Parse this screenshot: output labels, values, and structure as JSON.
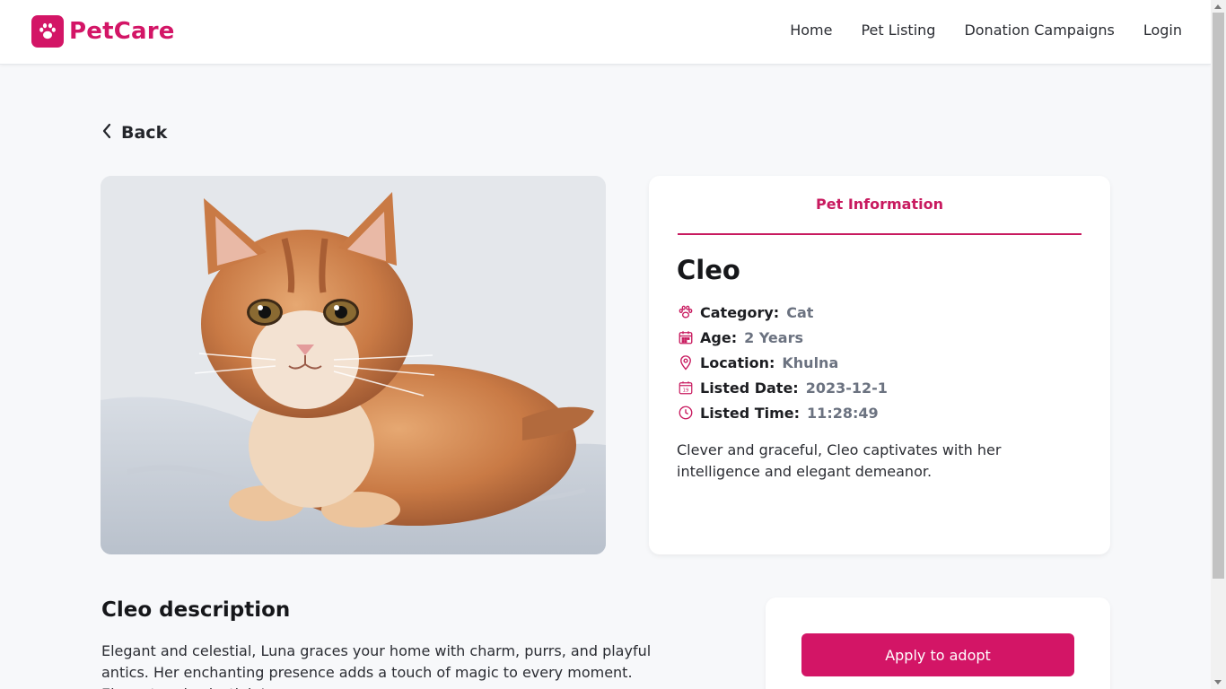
{
  "brand": {
    "name": "PetCare",
    "color": "#d31566",
    "icon": "paw-icon"
  },
  "nav": {
    "items": [
      "Home",
      "Pet Listing",
      "Donation Campaigns",
      "Login"
    ]
  },
  "page_progress": 0.2,
  "back": {
    "label": "Back",
    "icon": "chevron-left-icon"
  },
  "image": {
    "subject": "cat"
  },
  "info": {
    "tab_title": "Pet Information",
    "name": "Cleo",
    "facts": [
      {
        "icon": "paw-icon",
        "label": "Category:",
        "value": "Cat"
      },
      {
        "icon": "calendar-icon",
        "label": "Age:",
        "value": "2 Years"
      },
      {
        "icon": "location-pin-icon",
        "label": "Location:",
        "value": "Khulna"
      },
      {
        "icon": "calendar-date-icon",
        "label": "Listed Date:",
        "value": "2023-12-1"
      },
      {
        "icon": "clock-icon",
        "label": "Listed Time:",
        "value": "11:28:49"
      }
    ],
    "blurb": "Clever and graceful, Cleo captivates with her intelligence and elegant demeanor."
  },
  "description": {
    "title": "Cleo description",
    "body": "Elegant and celestial, Luna graces your home with charm, purrs, and playful antics. Her enchanting presence adds a touch of magic to every moment. Elegant and celestial, Luna"
  },
  "adopt": {
    "button_label": "Apply to adopt"
  },
  "colors": {
    "accent": "#d31566",
    "accent_dark": "#c81a5f",
    "muted_value": "#6b7280",
    "background": "#f7f8fa"
  }
}
